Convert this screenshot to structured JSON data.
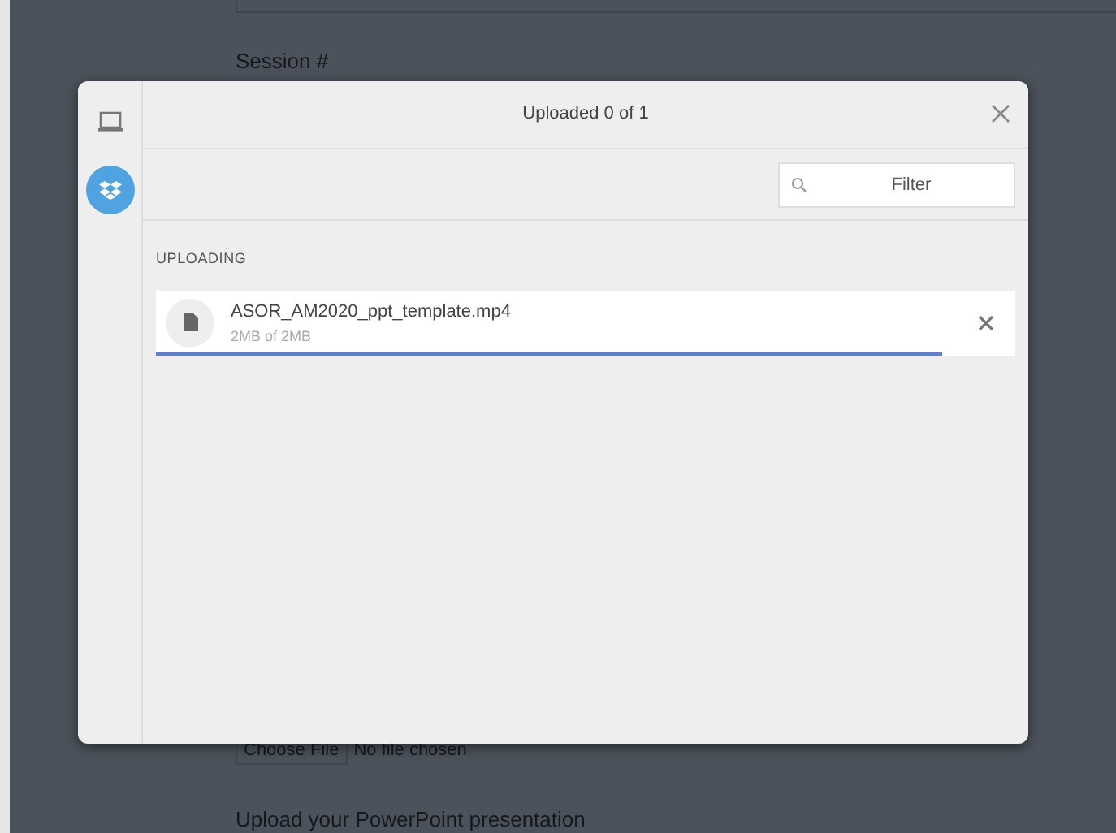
{
  "background_page": {
    "section_label": "Session #",
    "choose_file_button": "Choose File",
    "file_status": "No file chosen",
    "upload_label": "Upload your PowerPoint presentation"
  },
  "sidebar": {
    "items": [
      {
        "kind": "computer",
        "selected": false
      },
      {
        "kind": "dropbox",
        "selected": true
      }
    ]
  },
  "dialog": {
    "title": "Uploaded 0 of 1",
    "filter": {
      "placeholder": "Filter"
    },
    "section_heading": "UPLOADING",
    "files": [
      {
        "name": "ASOR_AM2020_ppt_template.mp4",
        "size": "2MB of 2MB",
        "level": 0.915
      }
    ]
  }
}
